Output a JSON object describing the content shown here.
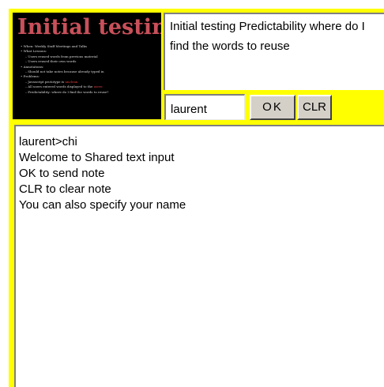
{
  "slide": {
    "title": "Initial testing",
    "bullets": [
      {
        "level": 1,
        "text": "When: Weekly Staff Meetings and Talks"
      },
      {
        "level": 1,
        "text": "What Lessons:"
      },
      {
        "level": 2,
        "text": "Users reused words from previous material"
      },
      {
        "level": 2,
        "text": "Users reused their own words"
      },
      {
        "level": 1,
        "text": "Annotations:"
      },
      {
        "level": 2,
        "text": "Should not take notes because already typed in"
      },
      {
        "level": 1,
        "text": "Problems:"
      },
      {
        "level": 2,
        "text": "Javascript prototype is ",
        "highlight": "unclean"
      },
      {
        "level": 2,
        "text": "All users entered words displayed to the ",
        "highlight": "users"
      },
      {
        "level": 2,
        "text": "Predictability: where do I find the words to reuse?"
      }
    ]
  },
  "topic_panel": {
    "text": "Initial testing Predictability where do I find the words to reuse"
  },
  "controls": {
    "name_value": "laurent",
    "ok_label": "OK",
    "clr_label": "CLR"
  },
  "notes": {
    "lines": [
      "laurent>chi",
      "Welcome to Shared text input",
      "OK to send note",
      "CLR to clear note",
      "You can also specify your name"
    ]
  },
  "colors": {
    "frame_background": "#ffff00",
    "slide_background": "#000000",
    "slide_title": "#c8505a"
  }
}
